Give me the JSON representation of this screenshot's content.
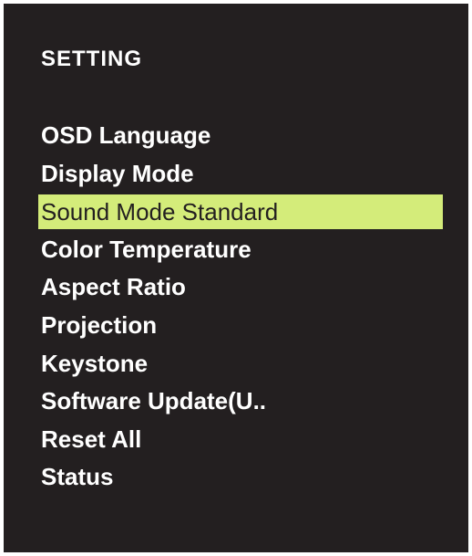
{
  "menu": {
    "title": "SETTING",
    "items": [
      {
        "label": "OSD Language"
      },
      {
        "label": "Display Mode"
      },
      {
        "label": "Sound Mode Standard"
      },
      {
        "label": "Color Temperature"
      },
      {
        "label": "Aspect Ratio"
      },
      {
        "label": "Projection"
      },
      {
        "label": "Keystone"
      },
      {
        "label": "Software Update(U.."
      },
      {
        "label": "Reset All"
      },
      {
        "label": "Status"
      }
    ],
    "selected_label": "Sound Mode Standard"
  },
  "colors": {
    "background": "#231f20",
    "text": "#ffffff",
    "highlight": "#d4ec7a",
    "highlight_text": "#231f20"
  }
}
